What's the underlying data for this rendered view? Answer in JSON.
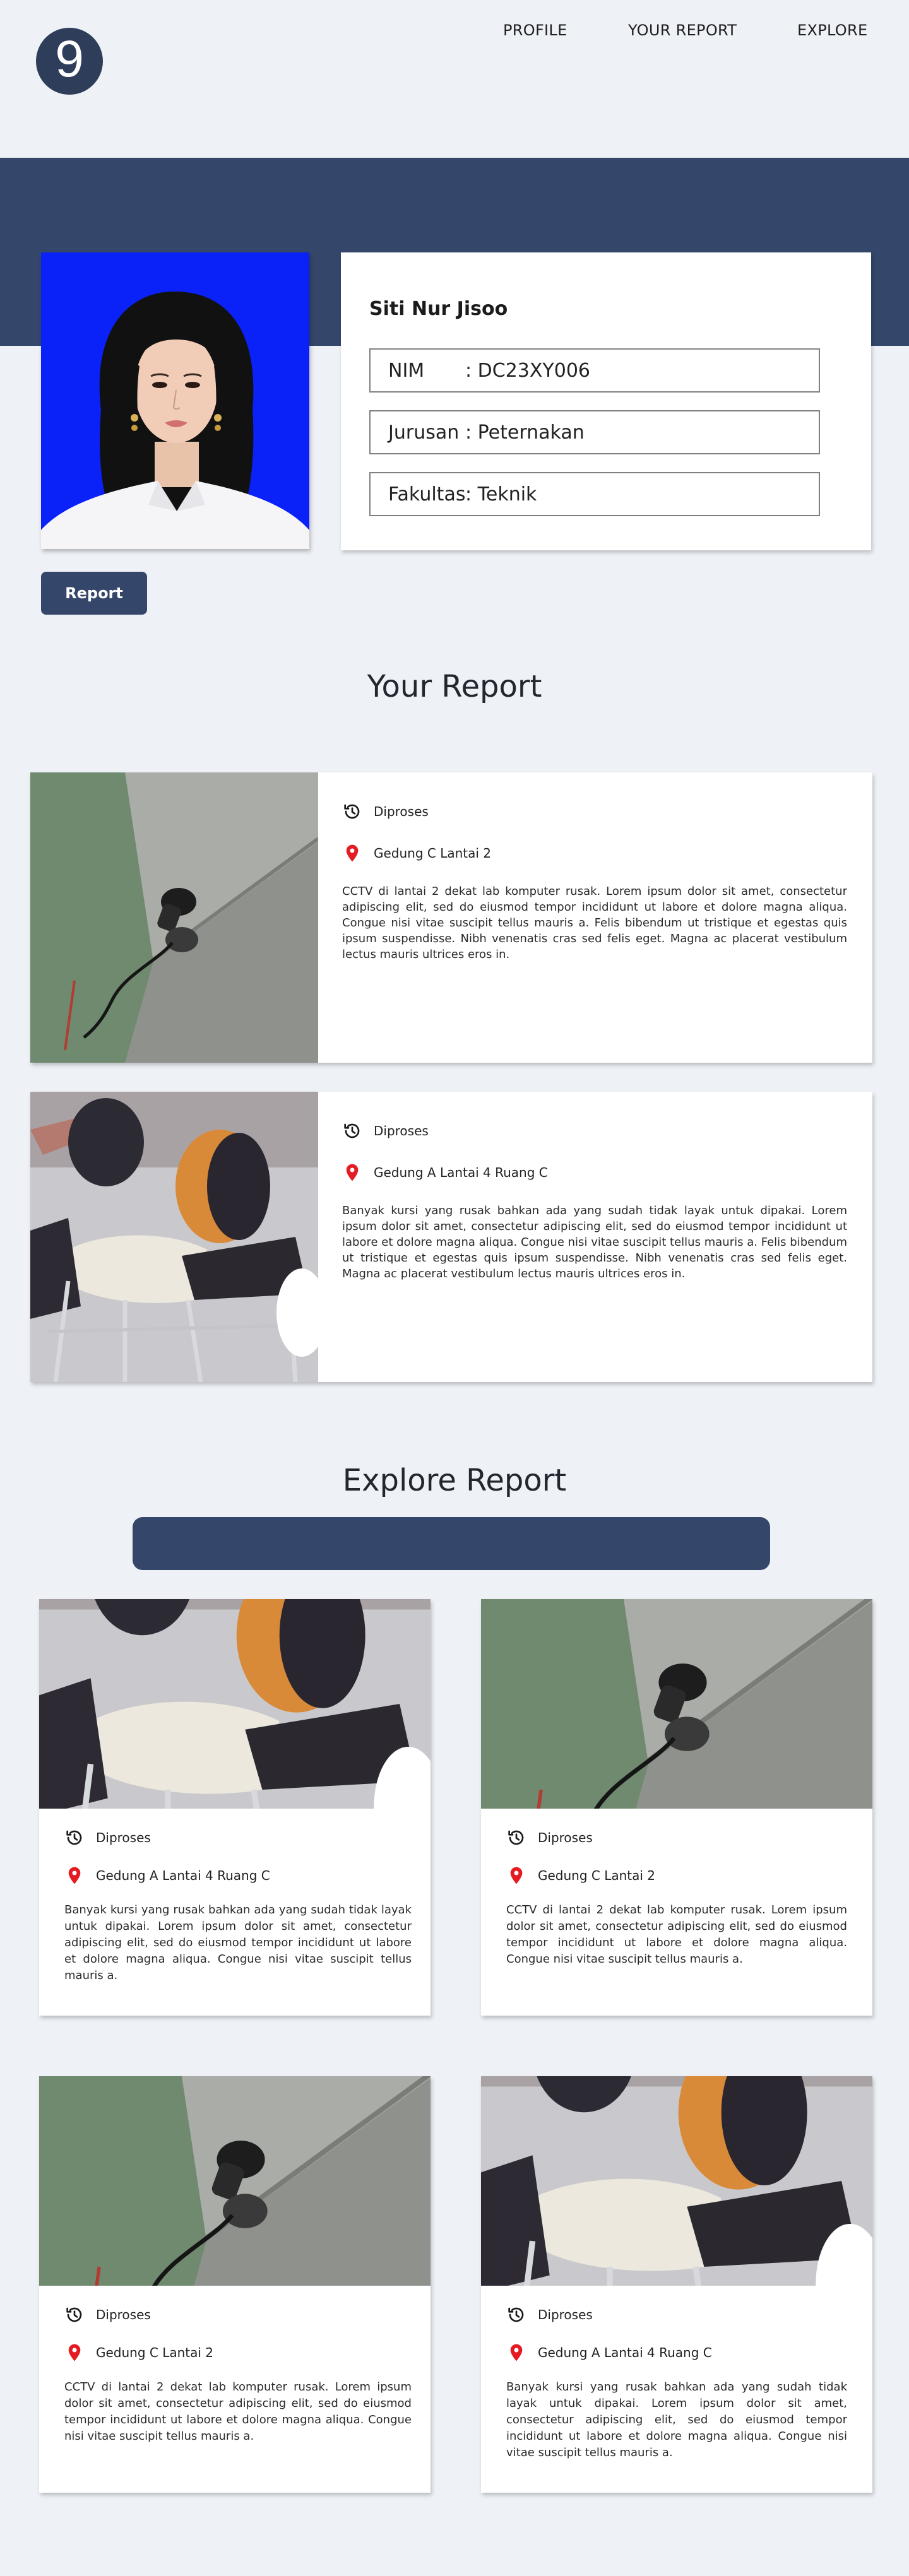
{
  "nav": {
    "logo_glyph": "9",
    "links": [
      "PROFILE",
      "YOUR REPORT",
      "EXPLORE"
    ]
  },
  "profile": {
    "name": "Siti Nur Jisoo",
    "fields": [
      {
        "label": "NIM",
        "value": ": DC23XY006"
      },
      {
        "label": "Jurusan",
        "value": ": Peternakan"
      },
      {
        "label": "Fakultas",
        "value": ": Teknik"
      }
    ],
    "report_button": "Report"
  },
  "your_report": {
    "title": "Your Report",
    "items": [
      {
        "status": "Diproses",
        "location": "Gedung C Lantai 2",
        "description": "CCTV di lantai 2 dekat lab komputer rusak. Lorem ipsum dolor sit amet, consectetur adipiscing elit, sed do eiusmod tempor incididunt ut labore et dolore magna aliqua. Congue nisi vitae suscipit tellus mauris a. Felis bibendum ut tristique et egestas quis ipsum suspendisse. Nibh venenatis cras sed felis eget. Magna ac placerat vestibulum lectus mauris ultrices eros in.",
        "image": "cctv"
      },
      {
        "status": "Diproses",
        "location": "Gedung A Lantai 4 Ruang C",
        "description": "Banyak kursi yang rusak bahkan ada yang sudah tidak layak untuk dipakai. Lorem ipsum dolor sit amet, consectetur adipiscing elit, sed do eiusmod tempor incididunt ut labore et dolore magna aliqua. Congue nisi vitae suscipit tellus mauris a. Felis bibendum ut tristique et egestas quis ipsum suspendisse. Nibh venenatis cras sed felis eget. Magna ac placerat vestibulum lectus mauris ultrices eros in.",
        "image": "chairs"
      }
    ]
  },
  "explore": {
    "title": "Explore Report",
    "items": [
      {
        "status": "Diproses",
        "location": "Gedung A Lantai 4 Ruang C",
        "description": "Banyak kursi yang rusak bahkan ada yang sudah tidak layak untuk dipakai. Lorem ipsum dolor sit amet, consectetur adipiscing elit, sed do eiusmod tempor incididunt ut labore et dolore magna aliqua. Congue nisi vitae suscipit tellus mauris a.",
        "image": "chairs"
      },
      {
        "status": "Diproses",
        "location": "Gedung C Lantai 2",
        "description": "CCTV di lantai 2 dekat lab komputer rusak. Lorem ipsum dolor sit amet, consectetur adipiscing elit, sed do eiusmod tempor incididunt ut labore et dolore magna aliqua. Congue nisi vitae suscipit tellus mauris a.",
        "image": "cctv"
      },
      {
        "status": "Diproses",
        "location": "Gedung C Lantai 2",
        "description": "CCTV di lantai 2 dekat lab komputer rusak. Lorem ipsum dolor sit amet, consectetur adipiscing elit, sed do eiusmod tempor incididunt ut labore et dolore magna aliqua. Congue nisi vitae suscipit tellus mauris a.",
        "image": "cctv"
      },
      {
        "status": "Diproses",
        "location": "Gedung A Lantai 4 Ruang C",
        "description": "Banyak kursi yang rusak bahkan ada yang sudah tidak layak untuk dipakai. Lorem ipsum dolor sit amet, consectetur adipiscing elit, sed do eiusmod tempor incididunt ut labore et dolore magna aliqua. Congue nisi vitae suscipit tellus mauris a.",
        "image": "chairs"
      }
    ]
  },
  "colors": {
    "brand": "#34476a",
    "background": "#eef1f6",
    "pin": "#e41b23",
    "photo_bg": "#0a21f8"
  },
  "icons": {
    "status": "history-icon",
    "location": "map-pin-icon"
  }
}
